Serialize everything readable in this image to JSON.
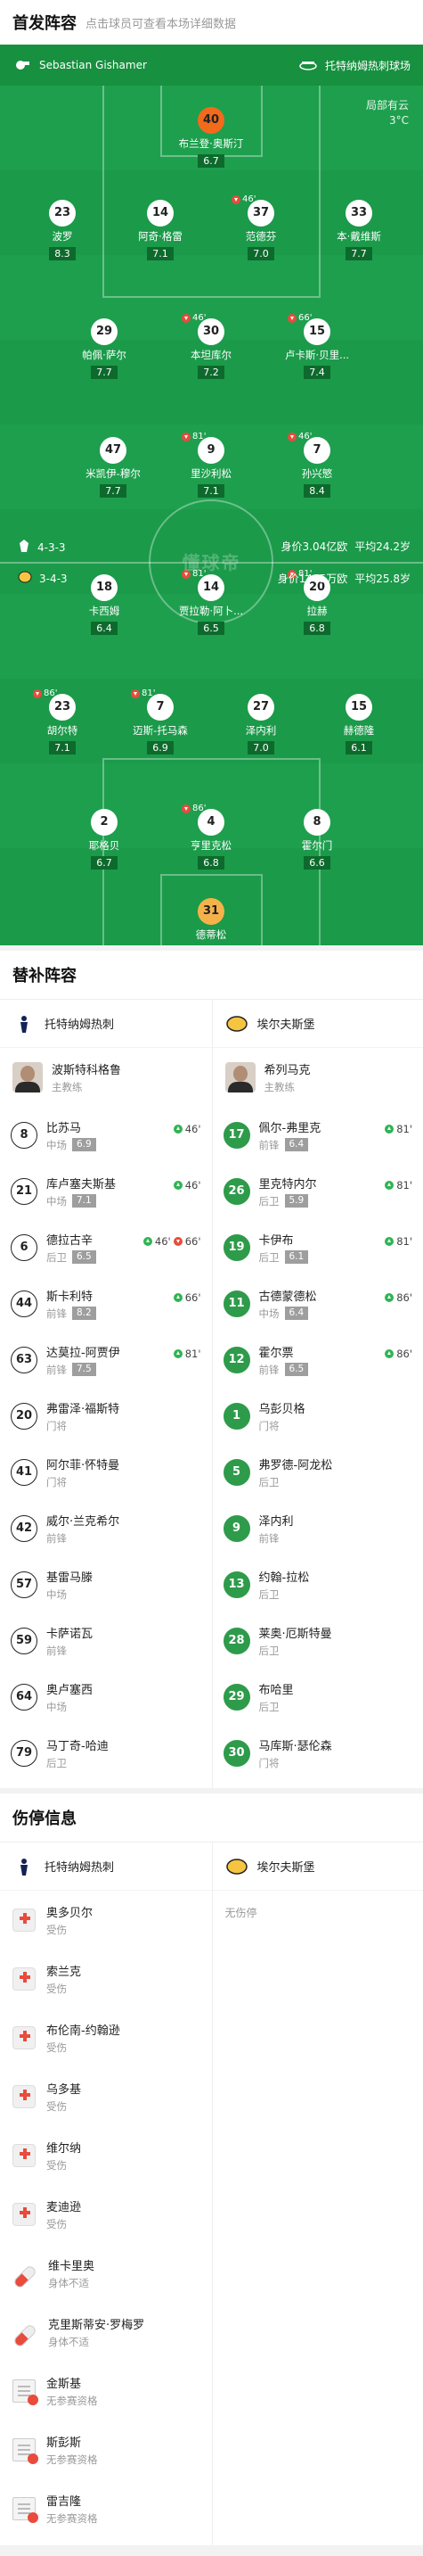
{
  "header": {
    "title": "首发阵容",
    "subtitle": "点击球员可查看本场详细数据"
  },
  "pitch": {
    "referee": "Sebastian Gishamer",
    "home_team": "托特纳姆热刺球场",
    "weather": "局部有云",
    "temp": "3°C",
    "home": {
      "formation": "4-3-3",
      "value": "身价3.04亿欧",
      "age": "平均24.2岁"
    },
    "away": {
      "formation": "3-4-3",
      "value": "身价1465万欧",
      "age": "平均25.8岁"
    },
    "watermark": "懂球帝",
    "players": [
      {
        "n": "40",
        "name": "布兰登·奥斯汀",
        "r": "6.7",
        "gk": true
      },
      {
        "n": "23",
        "name": "波罗",
        "r": "8.3"
      },
      {
        "n": "14",
        "name": "阿奇·格雷",
        "r": "7.1"
      },
      {
        "n": "37",
        "name": "范德芬",
        "r": "7.0",
        "sub": "46'"
      },
      {
        "n": "33",
        "name": "本·戴维斯",
        "r": "7.7"
      },
      {
        "n": "29",
        "name": "帕佩·萨尔",
        "r": "7.7"
      },
      {
        "n": "30",
        "name": "本坦库尔",
        "r": "7.2",
        "sub": "46'"
      },
      {
        "n": "15",
        "name": "卢卡斯·贝里...",
        "r": "7.4",
        "sub": "66'"
      },
      {
        "n": "47",
        "name": "米凯伊-穆尔",
        "r": "7.7"
      },
      {
        "n": "9",
        "name": "里沙利松",
        "r": "7.1",
        "sub": "81'"
      },
      {
        "n": "7",
        "name": "孙兴慜",
        "r": "8.4",
        "sub": "46'"
      },
      {
        "n": "18",
        "name": "卡西姆",
        "r": "6.4"
      },
      {
        "n": "14",
        "name": "贾拉勒·阿卜...",
        "r": "6.5",
        "sub": "81'"
      },
      {
        "n": "20",
        "name": "拉赫",
        "r": "6.8",
        "sub": "81'"
      },
      {
        "n": "23",
        "name": "胡尔特",
        "r": "7.1",
        "sub": "86'"
      },
      {
        "n": "7",
        "name": "迈斯-托马森",
        "r": "6.9",
        "sub": "81'"
      },
      {
        "n": "27",
        "name": "泽内利",
        "r": "7.0"
      },
      {
        "n": "15",
        "name": "赫德隆",
        "r": "6.1"
      },
      {
        "n": "2",
        "name": "耶格贝",
        "r": "6.7"
      },
      {
        "n": "4",
        "name": "亨里克松",
        "r": "6.8",
        "sub": "86'"
      },
      {
        "n": "8",
        "name": "霍尔门",
        "r": "6.6"
      },
      {
        "n": "31",
        "name": "德蒂松",
        "r": "7.2",
        "gk": true
      }
    ]
  },
  "subs": {
    "title": "替补阵容",
    "home_name": "托特纳姆热刺",
    "away_name": "埃尔夫斯堡",
    "home_coach": "波斯特科格鲁",
    "away_coach": "希列马克",
    "coach_label": "主教练",
    "home": [
      {
        "n": "8",
        "name": "比苏马",
        "pos": "中场",
        "r": "6.9",
        "ev": "46'"
      },
      {
        "n": "21",
        "name": "库卢塞夫斯基",
        "pos": "中场",
        "r": "7.1",
        "ev": "46'"
      },
      {
        "n": "6",
        "name": "德拉古辛",
        "pos": "后卫",
        "r": "6.5",
        "ev": "46'",
        "ev2": "66'"
      },
      {
        "n": "44",
        "name": "斯卡利特",
        "pos": "前锋",
        "r": "8.2",
        "ev": "66'"
      },
      {
        "n": "63",
        "name": "达莫拉-阿贾伊",
        "pos": "前锋",
        "r": "7.5",
        "ev": "81'"
      },
      {
        "n": "20",
        "name": "弗雷泽·福斯特",
        "pos": "门将"
      },
      {
        "n": "41",
        "name": "阿尔菲·怀特曼",
        "pos": "门将"
      },
      {
        "n": "42",
        "name": "威尔·兰克希尔",
        "pos": "前锋"
      },
      {
        "n": "57",
        "name": "基雷马滕",
        "pos": "中场"
      },
      {
        "n": "59",
        "name": "卡萨诺瓦",
        "pos": "前锋"
      },
      {
        "n": "64",
        "name": "奥卢塞西",
        "pos": "中场"
      },
      {
        "n": "79",
        "name": "马丁奇-哈迪",
        "pos": "后卫"
      }
    ],
    "away": [
      {
        "n": "17",
        "name": "佩尔-弗里克",
        "pos": "前锋",
        "r": "6.4",
        "ev": "81'"
      },
      {
        "n": "26",
        "name": "里克特内尔",
        "pos": "后卫",
        "r": "5.9",
        "ev": "81'"
      },
      {
        "n": "19",
        "name": "卡伊布",
        "pos": "后卫",
        "r": "6.1",
        "ev": "81'"
      },
      {
        "n": "11",
        "name": "古德蒙德松",
        "pos": "中场",
        "r": "6.4",
        "ev": "86'"
      },
      {
        "n": "12",
        "name": "霍尔票",
        "pos": "前锋",
        "r": "6.5",
        "ev": "86'"
      },
      {
        "n": "1",
        "name": "乌彭贝格",
        "pos": "门将"
      },
      {
        "n": "5",
        "name": "弗罗德-阿龙松",
        "pos": "后卫"
      },
      {
        "n": "9",
        "name": "泽内利",
        "pos": "前锋"
      },
      {
        "n": "13",
        "name": "约翰-拉松",
        "pos": "后卫"
      },
      {
        "n": "28",
        "name": "莱奥·厄斯特曼",
        "pos": "后卫"
      },
      {
        "n": "29",
        "name": "布哈里",
        "pos": "后卫"
      },
      {
        "n": "30",
        "name": "马库斯·瑟伦森",
        "pos": "门将"
      }
    ]
  },
  "injuries": {
    "title": "伤停信息",
    "none": "无伤停",
    "list": [
      {
        "name": "奥多贝尔",
        "reason": "受伤",
        "t": "kit"
      },
      {
        "name": "索兰克",
        "reason": "受伤",
        "t": "kit"
      },
      {
        "name": "布伦南-约翰逊",
        "reason": "受伤",
        "t": "kit"
      },
      {
        "name": "乌多基",
        "reason": "受伤",
        "t": "kit"
      },
      {
        "name": "维尔纳",
        "reason": "受伤",
        "t": "kit"
      },
      {
        "name": "麦迪逊",
        "reason": "受伤",
        "t": "kit"
      },
      {
        "name": "维卡里奥",
        "reason": "身体不适",
        "t": "pill"
      },
      {
        "name": "克里斯蒂安·罗梅罗",
        "reason": "身体不适",
        "t": "pill"
      },
      {
        "name": "金斯基",
        "reason": "无参赛资格",
        "t": "doc"
      },
      {
        "name": "斯彭斯",
        "reason": "无参赛资格",
        "t": "doc"
      },
      {
        "name": "雷吉隆",
        "reason": "无参赛资格",
        "t": "doc"
      }
    ]
  }
}
